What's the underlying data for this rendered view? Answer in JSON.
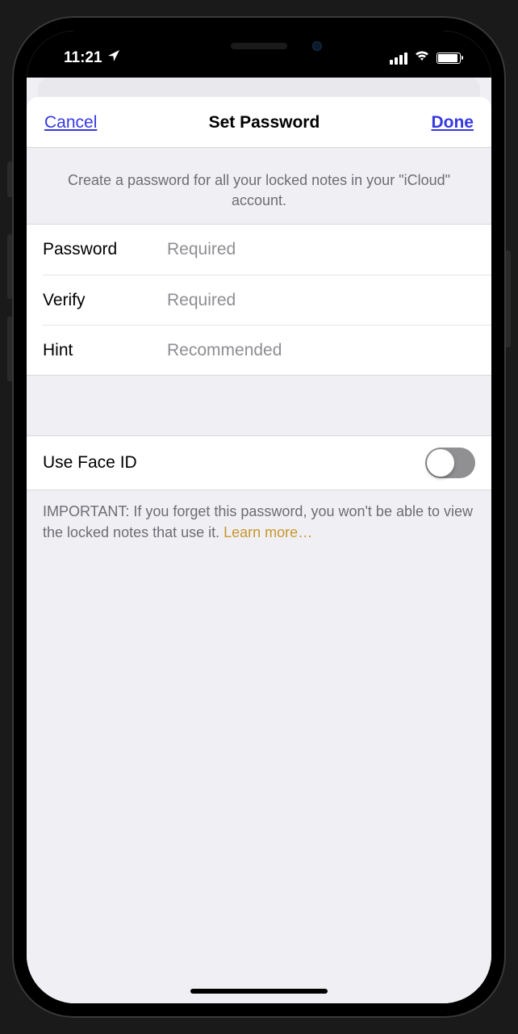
{
  "status": {
    "time": "11:21"
  },
  "nav": {
    "cancel": "Cancel",
    "title": "Set Password",
    "done": "Done"
  },
  "header": {
    "text": "Create a password for all your locked notes in your \"iCloud\" account."
  },
  "fields": {
    "password": {
      "label": "Password",
      "placeholder": "Required"
    },
    "verify": {
      "label": "Verify",
      "placeholder": "Required"
    },
    "hint": {
      "label": "Hint",
      "placeholder": "Recommended"
    }
  },
  "toggle": {
    "label": "Use Face ID"
  },
  "footer": {
    "text": "IMPORTANT: If you forget this password, you won't be able to view the locked notes that use it. ",
    "link": "Learn more…"
  }
}
